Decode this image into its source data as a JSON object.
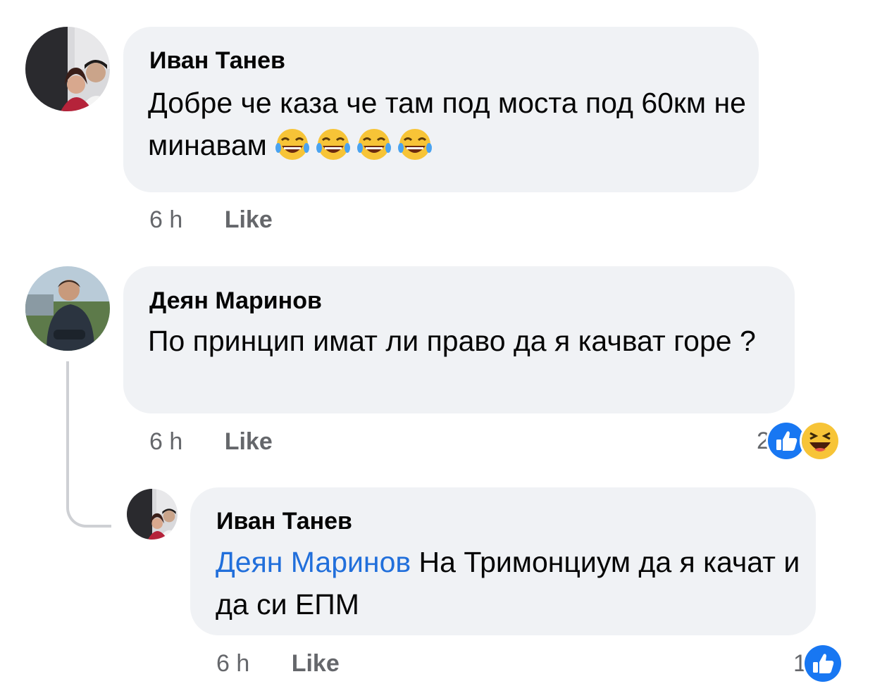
{
  "comments": [
    {
      "author": "Иван Танев",
      "text": "Добре че каза че там под моста под 60км не минавам",
      "emojis": [
        "😂",
        "😂",
        "😂",
        "😂"
      ],
      "time": "6 h",
      "like_label": "Like"
    },
    {
      "author": "Деян Маринов",
      "text": "По принцип имат ли право да я качват горе ?",
      "time": "6 h",
      "like_label": "Like",
      "reactions": {
        "count": "2",
        "types": [
          "like-icon",
          "haha-icon"
        ]
      }
    }
  ],
  "reply": {
    "author": "Иван Танев",
    "mention": "Деян Маринов",
    "text": " На Тримонциум да я качат и да си ЕПМ",
    "time": "6 h",
    "like_label": "Like",
    "reactions": {
      "count": "1",
      "types": [
        "like-icon"
      ]
    }
  },
  "colors": {
    "bubble": "#f0f2f5",
    "meta": "#65676b",
    "mention": "#216fdb",
    "like_blue": "#1877f2"
  }
}
